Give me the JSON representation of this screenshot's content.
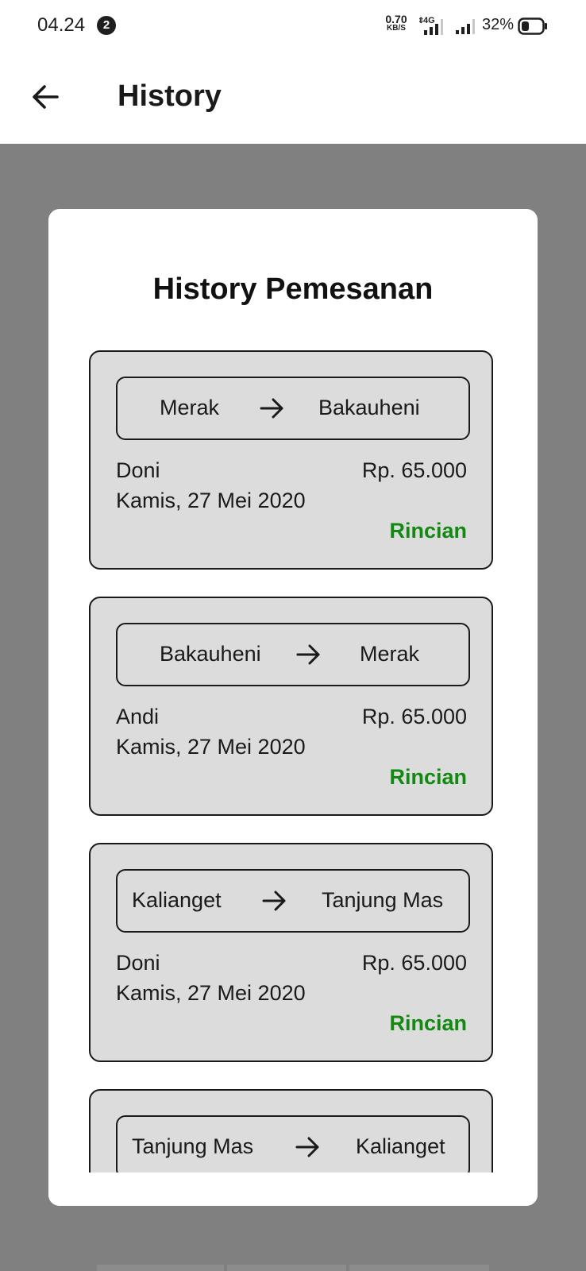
{
  "status_bar": {
    "time": "04.24",
    "notification_count": "2",
    "speed_value": "0.70",
    "speed_unit": "KB/S",
    "network_type": "4G",
    "battery_percent": "32%"
  },
  "app_bar": {
    "title": "History",
    "back_icon": "arrow-left-icon"
  },
  "dialog": {
    "title": "History Pemesanan",
    "orders": [
      {
        "from": "Merak",
        "to": "Bakauheni",
        "name": "Doni",
        "date": "Kamis, 27 Mei 2020",
        "price": "Rp. 65.000",
        "link": "Rincian"
      },
      {
        "from": "Bakauheni",
        "to": "Merak",
        "name": "Andi",
        "date": "Kamis, 27 Mei 2020",
        "price": "Rp. 65.000",
        "link": "Rincian"
      },
      {
        "from": "Kalianget",
        "to": "Tanjung Mas",
        "name": "Doni",
        "date": "Kamis, 27 Mei 2020",
        "price": "Rp. 65.000",
        "link": "Rincian"
      },
      {
        "from": "Tanjung Mas",
        "to": "Kalianget",
        "name": "",
        "date": "",
        "price": "",
        "link": ""
      }
    ]
  },
  "colors": {
    "backdrop": "#808080",
    "card_bg": "#dcdcdc",
    "link": "#128a12"
  }
}
